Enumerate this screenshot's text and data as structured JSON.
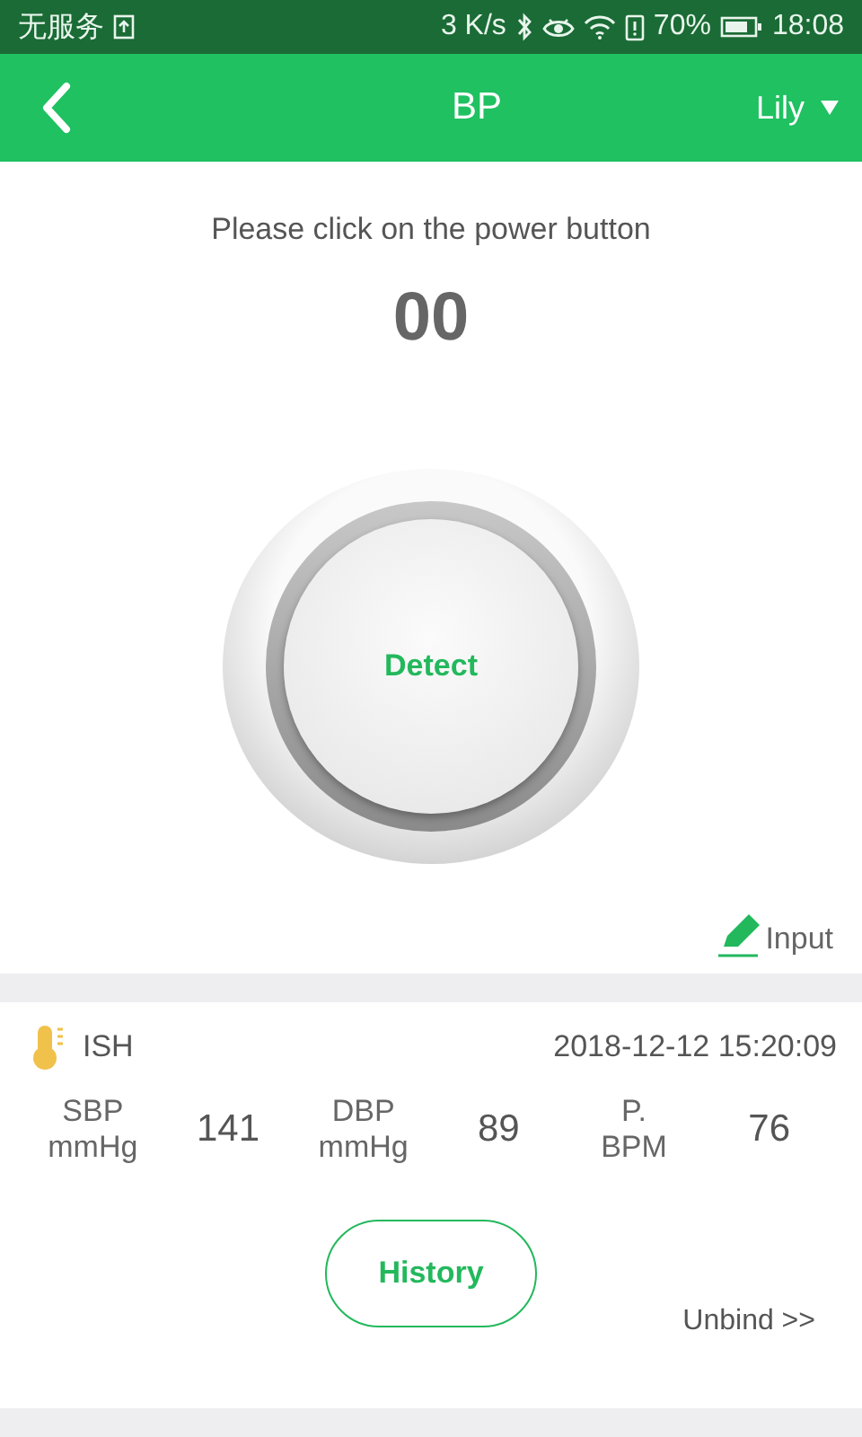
{
  "status_bar": {
    "carrier": "无服务",
    "speed": "3 K/s",
    "battery": "70%",
    "time": "18:08"
  },
  "app_bar": {
    "title": "BP",
    "user": "Lily"
  },
  "measure": {
    "prompt": "Please click on the power button",
    "reading": "00",
    "detect": "Detect",
    "input": "Input"
  },
  "record": {
    "tag": "ISH",
    "datetime": "2018-12-12 15:20:09",
    "values": [
      {
        "label": "SBP\nmmHg",
        "value": "141"
      },
      {
        "label": "DBP\nmmHg",
        "value": "89"
      },
      {
        "label": "P.\nBPM",
        "value": "76"
      }
    ],
    "history": "History",
    "unbind": "Unbind >>"
  }
}
